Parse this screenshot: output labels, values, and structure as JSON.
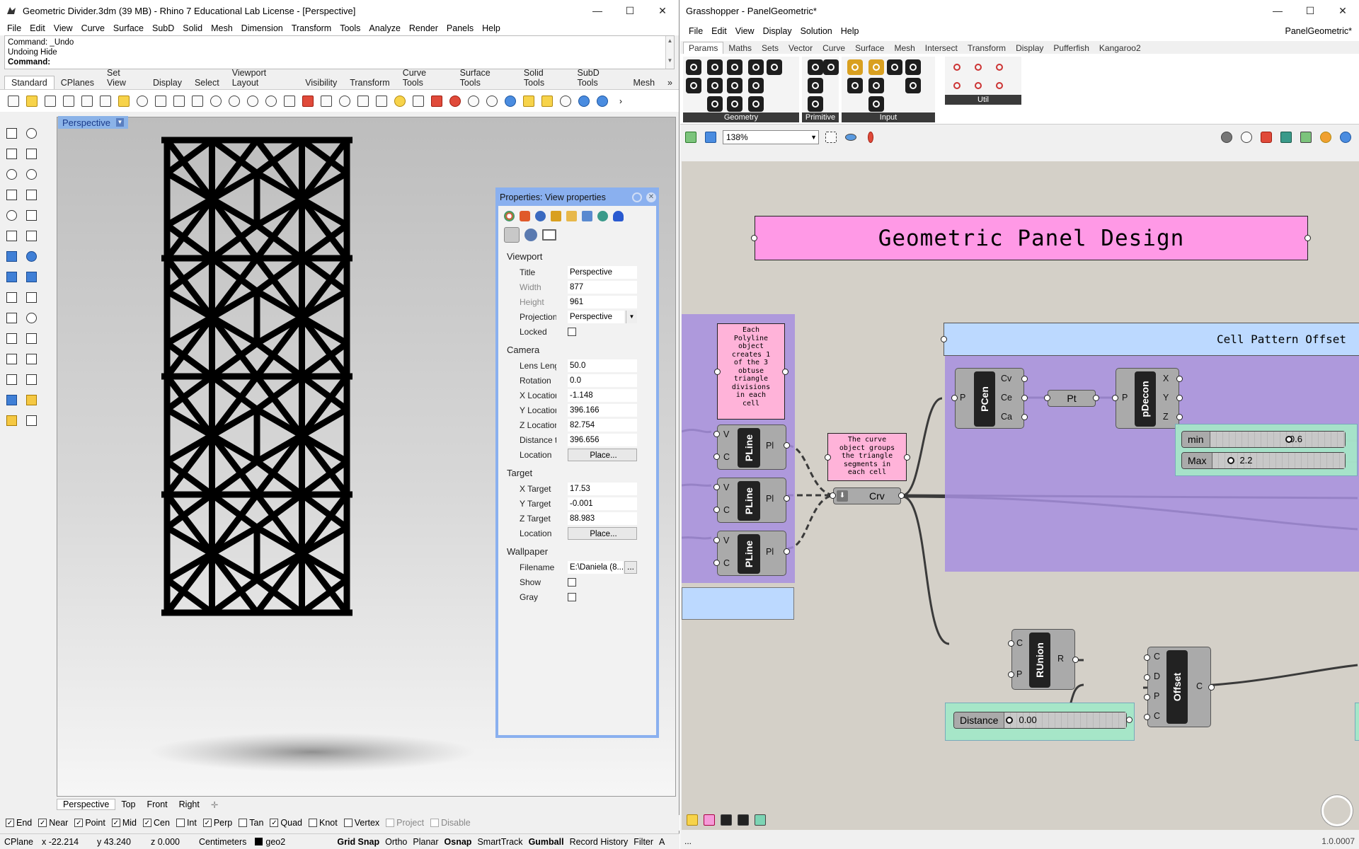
{
  "rhino": {
    "title": "Geometric Divider.3dm (39 MB) - Rhino 7 Educational Lab License - [Perspective]",
    "menu": [
      "File",
      "Edit",
      "View",
      "Curve",
      "Surface",
      "SubD",
      "Solid",
      "Mesh",
      "Dimension",
      "Transform",
      "Tools",
      "Analyze",
      "Render",
      "Panels",
      "Help"
    ],
    "command_history": [
      "Command: _Undo",
      "Undoing Hide"
    ],
    "command_prompt": "Command:",
    "toolbar_tabs": [
      "Standard",
      "CPlanes",
      "Set View",
      "Display",
      "Select",
      "Viewport Layout",
      "Visibility",
      "Transform",
      "Curve Tools",
      "Surface Tools",
      "Solid Tools",
      "SubD Tools",
      "Mesh"
    ],
    "toolbar_more": "»",
    "viewport_label": "Perspective",
    "view_tabs": [
      "Perspective",
      "Top",
      "Front",
      "Right"
    ],
    "view_tab_add": "✛",
    "osnaps": [
      {
        "label": "End",
        "checked": true
      },
      {
        "label": "Near",
        "checked": true
      },
      {
        "label": "Point",
        "checked": true
      },
      {
        "label": "Mid",
        "checked": true
      },
      {
        "label": "Cen",
        "checked": true
      },
      {
        "label": "Int",
        "checked": false
      },
      {
        "label": "Perp",
        "checked": true
      },
      {
        "label": "Tan",
        "checked": false
      },
      {
        "label": "Quad",
        "checked": true
      },
      {
        "label": "Knot",
        "checked": false
      },
      {
        "label": "Vertex",
        "checked": false
      },
      {
        "label": "Project",
        "checked": false,
        "dim": true
      },
      {
        "label": "Disable",
        "checked": false,
        "dim": true
      }
    ],
    "status": {
      "cplane": "CPlane",
      "x": "x -22.214",
      "y": "y 43.240",
      "z": "z 0.000",
      "units": "Centimeters",
      "layer": "geo2",
      "toggles": [
        "Grid Snap",
        "Ortho",
        "Planar",
        "Osnap",
        "SmartTrack",
        "Gumball",
        "Record History",
        "Filter",
        "A"
      ],
      "bold_toggles": [
        "Grid Snap",
        "Osnap",
        "Gumball"
      ]
    }
  },
  "properties": {
    "title": "Properties: View properties",
    "close_glyph": "✕",
    "sections": {
      "viewport": {
        "label": "Viewport",
        "rows": [
          {
            "k": "Title",
            "v": "Perspective"
          },
          {
            "k": "Width",
            "v": "877",
            "dim": true
          },
          {
            "k": "Height",
            "v": "961",
            "dim": true
          },
          {
            "k": "Projection",
            "v": "Perspective",
            "dropdown": true
          },
          {
            "k": "Locked",
            "checkbox": true
          }
        ]
      },
      "camera": {
        "label": "Camera",
        "rows": [
          {
            "k": "Lens Length...",
            "v": "50.0"
          },
          {
            "k": "Rotation",
            "v": "0.0"
          },
          {
            "k": "X Location",
            "v": "-1.148"
          },
          {
            "k": "Y Location",
            "v": "396.166"
          },
          {
            "k": "Z Location",
            "v": "82.754"
          },
          {
            "k": "Distance to ...",
            "v": "396.656"
          },
          {
            "k": "Location",
            "button": "Place..."
          }
        ]
      },
      "target": {
        "label": "Target",
        "rows": [
          {
            "k": "X Target",
            "v": "17.53"
          },
          {
            "k": "Y Target",
            "v": "-0.001"
          },
          {
            "k": "Z Target",
            "v": "88.983"
          },
          {
            "k": "Location",
            "button": "Place..."
          }
        ]
      },
      "wallpaper": {
        "label": "Wallpaper",
        "rows": [
          {
            "k": "Filename",
            "v": "E:\\Daniela (8...",
            "ellipsis": "..."
          },
          {
            "k": "Show",
            "checkbox": true
          },
          {
            "k": "Gray",
            "checkbox": true
          }
        ]
      }
    }
  },
  "grasshopper": {
    "title": "Grasshopper - PanelGeometric*",
    "menu": [
      "File",
      "Edit",
      "View",
      "Display",
      "Solution",
      "Help"
    ],
    "doc_name": "PanelGeometric*",
    "tabs": [
      "Params",
      "Maths",
      "Sets",
      "Vector",
      "Curve",
      "Surface",
      "Mesh",
      "Intersect",
      "Transform",
      "Display",
      "Pufferfish",
      "Kangaroo2"
    ],
    "ribbon_groups": [
      "Geometry",
      "Primitive",
      "Input",
      "Util"
    ],
    "zoom": "138%",
    "zoom_dd": "▼",
    "canvas": {
      "group_title": "Geometric Panel Design",
      "group_offset": "Cell Pattern Offset",
      "note1": "Each\nPolyline\nobject\ncreates 1\nof the 3\nobtuse\ntriangle\ndivisions\nin each\ncell",
      "note2": "The curve\nobject groups\nthe triangle\nsegments in\neach cell",
      "pline": {
        "name": "PLine",
        "in1": "V",
        "in2": "C",
        "out": "Pl"
      },
      "crv": {
        "name": "Crv"
      },
      "pcen": {
        "name": "PCen",
        "in": "P",
        "out": [
          "Cv",
          "Ce",
          "Ca"
        ]
      },
      "pt": {
        "name": "Pt"
      },
      "pdecon": {
        "name": "pDecon",
        "in": "P",
        "out": [
          "X",
          "Y",
          "Z"
        ]
      },
      "runion": {
        "name": "RUnion",
        "in": [
          "C",
          "P"
        ],
        "out": "R"
      },
      "offset": {
        "name": "Offset",
        "in": [
          "C",
          "D",
          "P",
          "C"
        ],
        "out": "C"
      },
      "slider_min": {
        "name": "min",
        "value": "0.6",
        "fraction": 0.55
      },
      "slider_max": {
        "name": "Max",
        "value": "2.2",
        "fraction": 0.1
      },
      "slider_dist": {
        "name": "Distance",
        "value": "0.00",
        "fraction": 0.0
      }
    },
    "status_left": "...",
    "version": "1.0.0007"
  },
  "window_controls": {
    "min": "—",
    "max": "☐",
    "close": "✕"
  }
}
